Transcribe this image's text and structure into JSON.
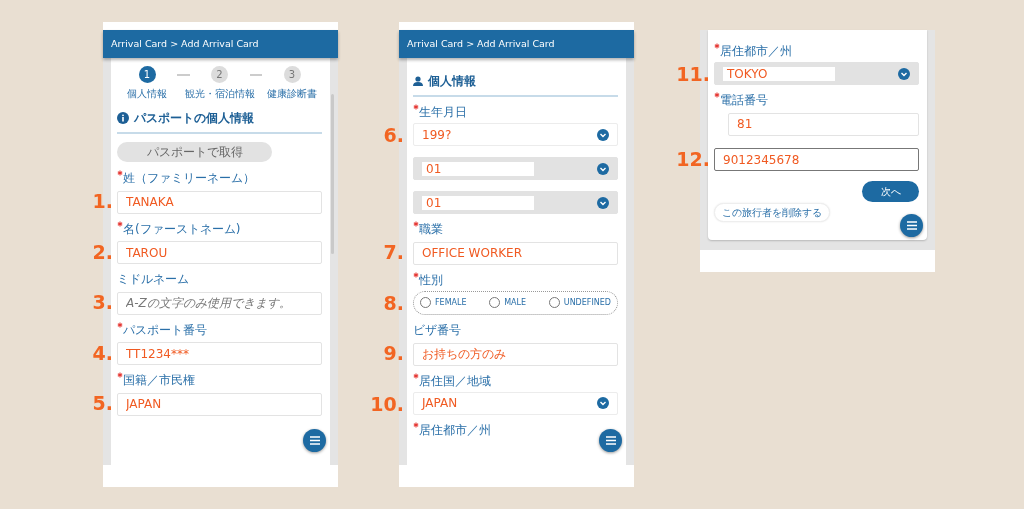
{
  "panels": [
    {
      "header": "Arrival Card > Add Arrival Card",
      "steps": [
        {
          "number": "1",
          "label": "個人情報",
          "selected": true
        },
        {
          "number": "2",
          "label": "観光・宿泊情報",
          "selected": false
        },
        {
          "number": "3",
          "label": "健康診断書",
          "selected": false
        }
      ],
      "section": {
        "title": "パスポートの個人情報"
      },
      "passport_button": "パスポートで取得",
      "items": [
        {
          "kind": "field",
          "label": "姓（ファミリーネーム）",
          "required": true,
          "value": "TANAKA",
          "marker": "1."
        },
        {
          "kind": "field",
          "label": "名(ファーストネーム)",
          "required": true,
          "value": "TAROU",
          "marker": "2."
        },
        {
          "kind": "field",
          "label": "ミドルネーム",
          "required": false,
          "placeholder": "A-Zの文字のみ使用できます。",
          "marker": "3."
        },
        {
          "kind": "field",
          "label": "パスポート番号",
          "required": true,
          "value": "TT1234***",
          "marker": "4."
        },
        {
          "kind": "field",
          "label": "国籍／市民権",
          "required": true,
          "value": "JAPAN",
          "marker": "5."
        }
      ]
    },
    {
      "header": "Arrival Card > Add Arrival Card",
      "section": {
        "title": "個人情報"
      },
      "items": [
        {
          "kind": "select",
          "label": "生年月日",
          "required": true,
          "value": "199?",
          "disabled": false,
          "marker": "6."
        },
        {
          "kind": "select",
          "value": "01",
          "disabled": true
        },
        {
          "kind": "select",
          "value": "01",
          "disabled": true
        },
        {
          "kind": "field",
          "label": "職業",
          "required": true,
          "value": "OFFICE WORKER",
          "marker": "7."
        },
        {
          "kind": "radio",
          "label": "性別",
          "required": true,
          "marker": "8.",
          "options": [
            {
              "label": "FEMALE",
              "selected": false
            },
            {
              "label": "MALE",
              "selected": false
            },
            {
              "label": "UNDEFINED",
              "selected": false
            }
          ]
        },
        {
          "kind": "field",
          "label": "ビザ番号",
          "required": false,
          "value": "お持ちの方のみ",
          "marker": "9."
        },
        {
          "kind": "select",
          "label": "居住国／地域",
          "required": true,
          "value": "JAPAN",
          "disabled": false,
          "marker": "10."
        },
        {
          "kind": "label",
          "label": "居住都市／州",
          "required": true
        }
      ]
    },
    {
      "items": [
        {
          "kind": "select",
          "label": "居住都市／州",
          "required": true,
          "value": "TOKYO",
          "disabled": true,
          "marker": "11."
        },
        {
          "kind": "phone",
          "label": "電話番号",
          "required": true,
          "code": "81"
        },
        {
          "kind": "field",
          "value": "9012345678",
          "focused": true,
          "marker": "12."
        }
      ],
      "actions": [
        {
          "label": "次へ",
          "kind": "primary"
        },
        {
          "label": "この旅行者を削除する",
          "kind": "outline"
        }
      ]
    }
  ]
}
